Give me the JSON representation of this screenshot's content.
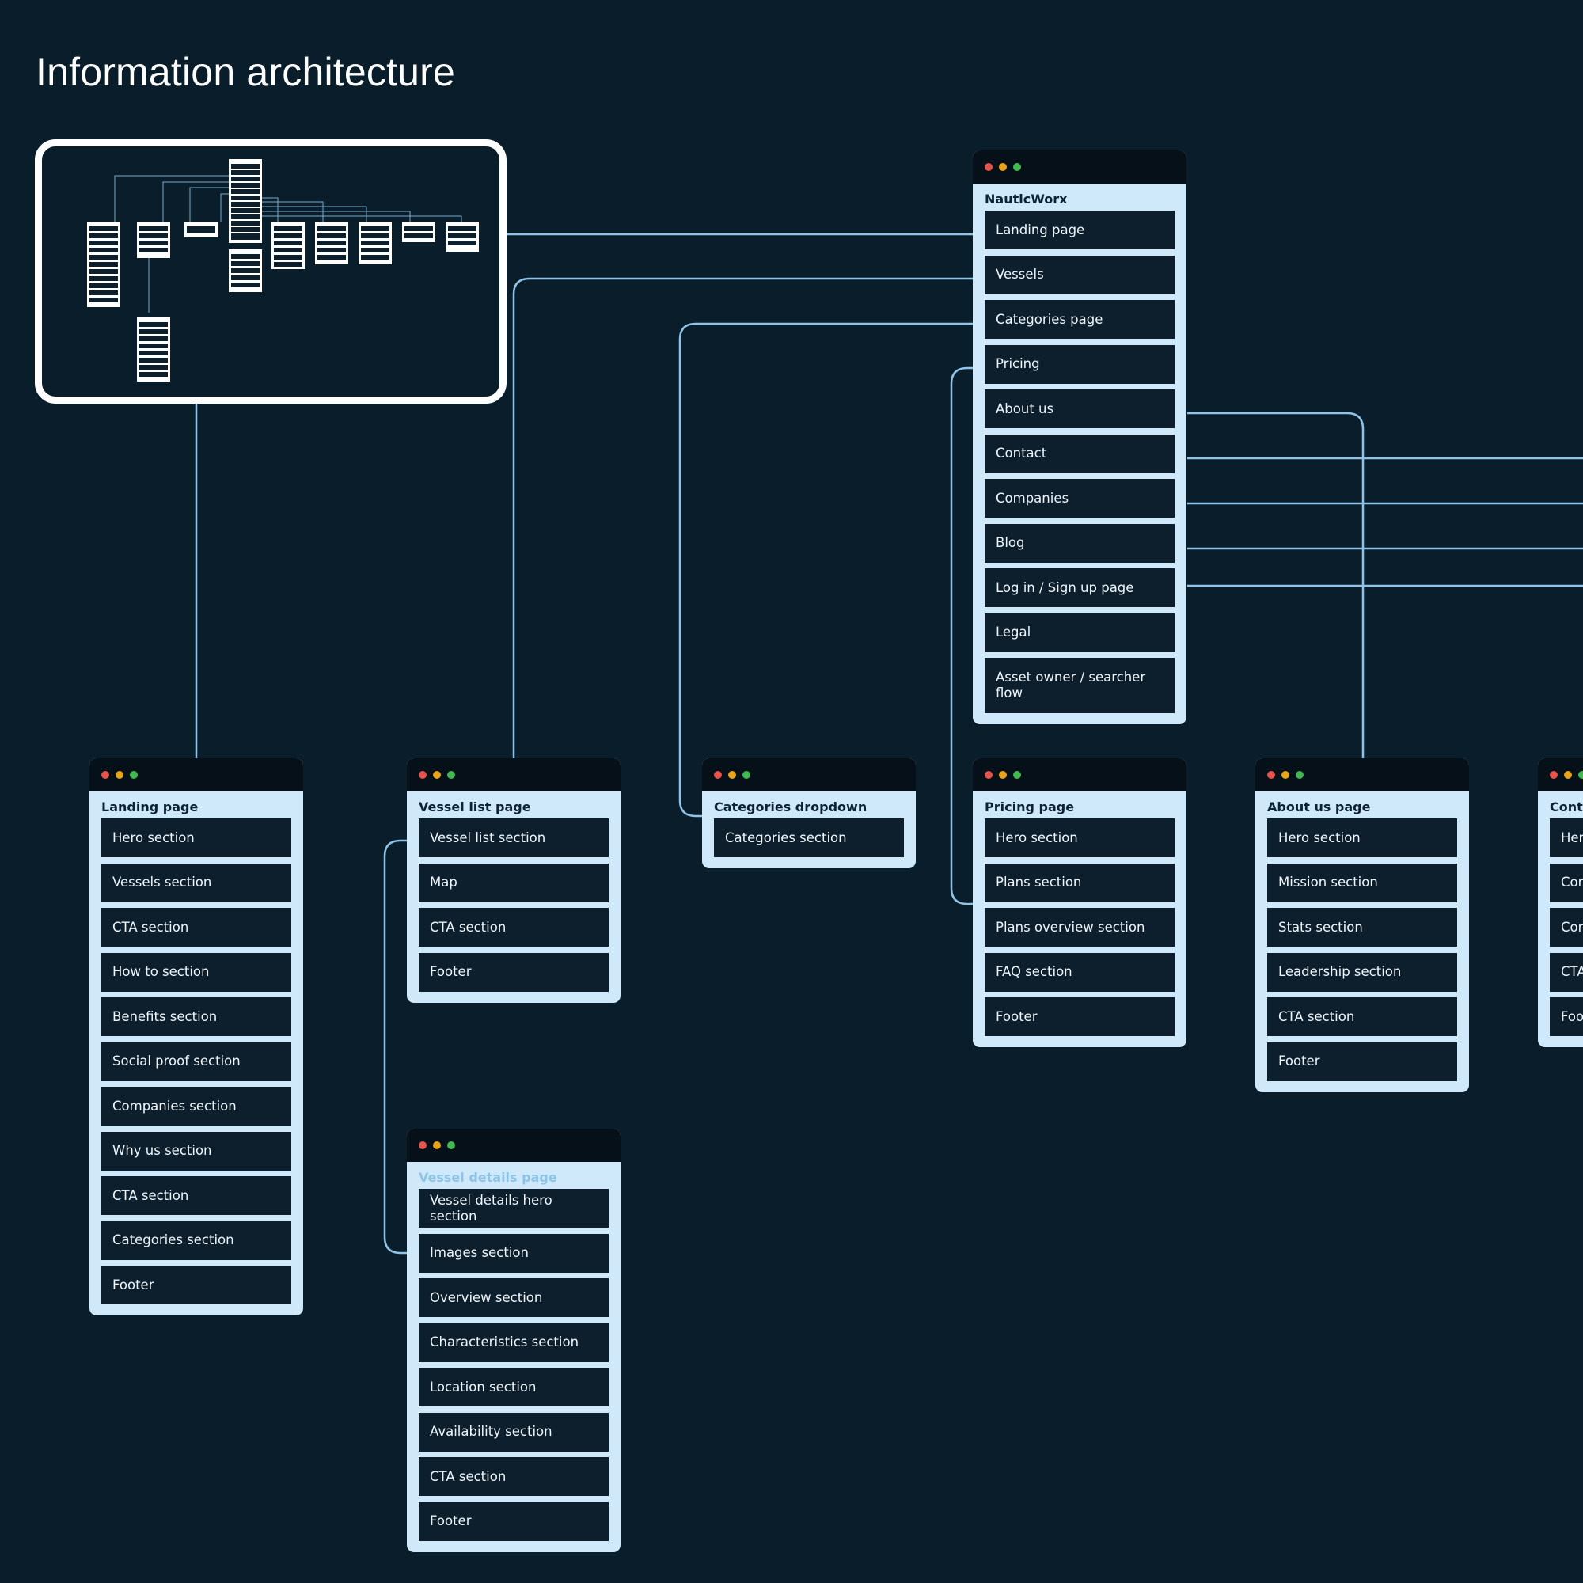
{
  "page_title": "Information architecture",
  "colors": {
    "background": "#0a1d2b",
    "connector": "#8fc4e8",
    "card": "#cfe9fb",
    "card_bar": "#061019",
    "item": "#0d1e2c"
  },
  "cards": {
    "root": {
      "title": "NauticWorx",
      "items": [
        "Landing page",
        "Vessels",
        "Categories page",
        "Pricing",
        "About us",
        "Contact",
        "Companies",
        "Blog",
        "Log in / Sign up page",
        "Legal",
        "Asset owner / searcher flow"
      ]
    },
    "landing": {
      "title": "Landing page",
      "items": [
        "Hero section",
        "Vessels section",
        "CTA section",
        "How to section",
        "Benefits section",
        "Social proof section",
        "Companies section",
        "Why us section",
        "CTA section",
        "Categories section",
        "Footer"
      ]
    },
    "vessel_list": {
      "title": "Vessel list page",
      "items": [
        "Vessel list section",
        "Map",
        "CTA section",
        "Footer"
      ]
    },
    "categories": {
      "title": "Categories dropdown",
      "items": [
        "Categories section"
      ]
    },
    "pricing": {
      "title": "Pricing page",
      "items": [
        "Hero section",
        "Plans section",
        "Plans overview section",
        "FAQ section",
        "Footer"
      ]
    },
    "about": {
      "title": "About us page",
      "items": [
        "Hero section",
        "Mission section",
        "Stats section",
        "Leadership section",
        "CTA section",
        "Footer"
      ]
    },
    "contact": {
      "title": "Conta",
      "items": [
        "Her",
        "Cor",
        "Cor",
        "CTA",
        "Foo"
      ]
    },
    "vessel_details": {
      "title": "Vessel details page",
      "items": [
        "Vessel details hero section",
        "Images section",
        "Overview section",
        "Characteristics section",
        "Location section",
        "Availability section",
        "CTA section",
        "Footer"
      ]
    }
  }
}
